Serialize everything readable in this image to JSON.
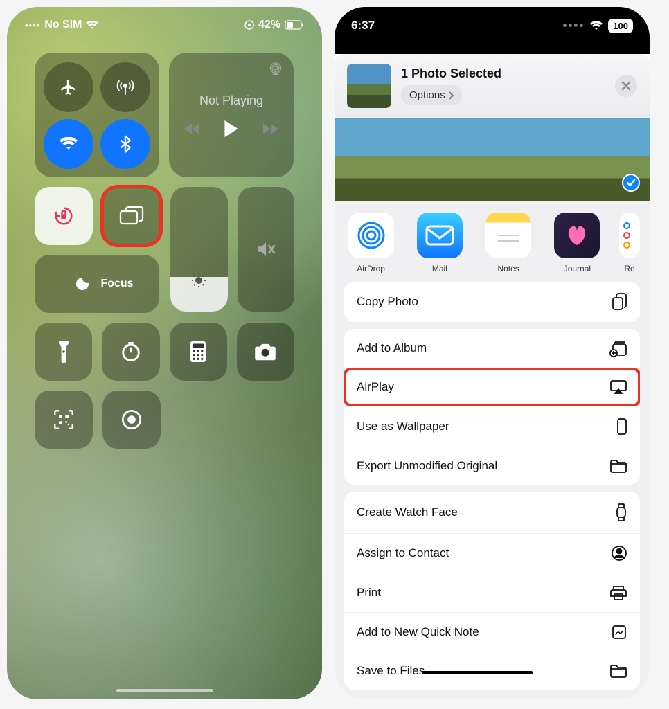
{
  "left": {
    "status": {
      "carrier": "No SIM",
      "battery_pct": "42%"
    },
    "media": {
      "state": "Not Playing"
    },
    "focus_label": "Focus"
  },
  "right": {
    "status": {
      "time": "6:37",
      "battery_pct": "100"
    },
    "header": {
      "title": "1 Photo Selected",
      "options": "Options"
    },
    "apps": [
      {
        "label": "AirDrop"
      },
      {
        "label": "Mail"
      },
      {
        "label": "Notes"
      },
      {
        "label": "Journal"
      },
      {
        "label": "Re"
      }
    ],
    "actions_group1": [
      {
        "label": "Copy Photo"
      }
    ],
    "actions_group2": [
      {
        "label": "Add to Album"
      },
      {
        "label": "AirPlay"
      },
      {
        "label": "Use as Wallpaper"
      },
      {
        "label": "Export Unmodified Original"
      }
    ],
    "actions_group3": [
      {
        "label": "Create Watch Face"
      },
      {
        "label": "Assign to Contact"
      },
      {
        "label": "Print"
      },
      {
        "label": "Add to New Quick Note"
      },
      {
        "label": "Save to Files"
      }
    ]
  }
}
